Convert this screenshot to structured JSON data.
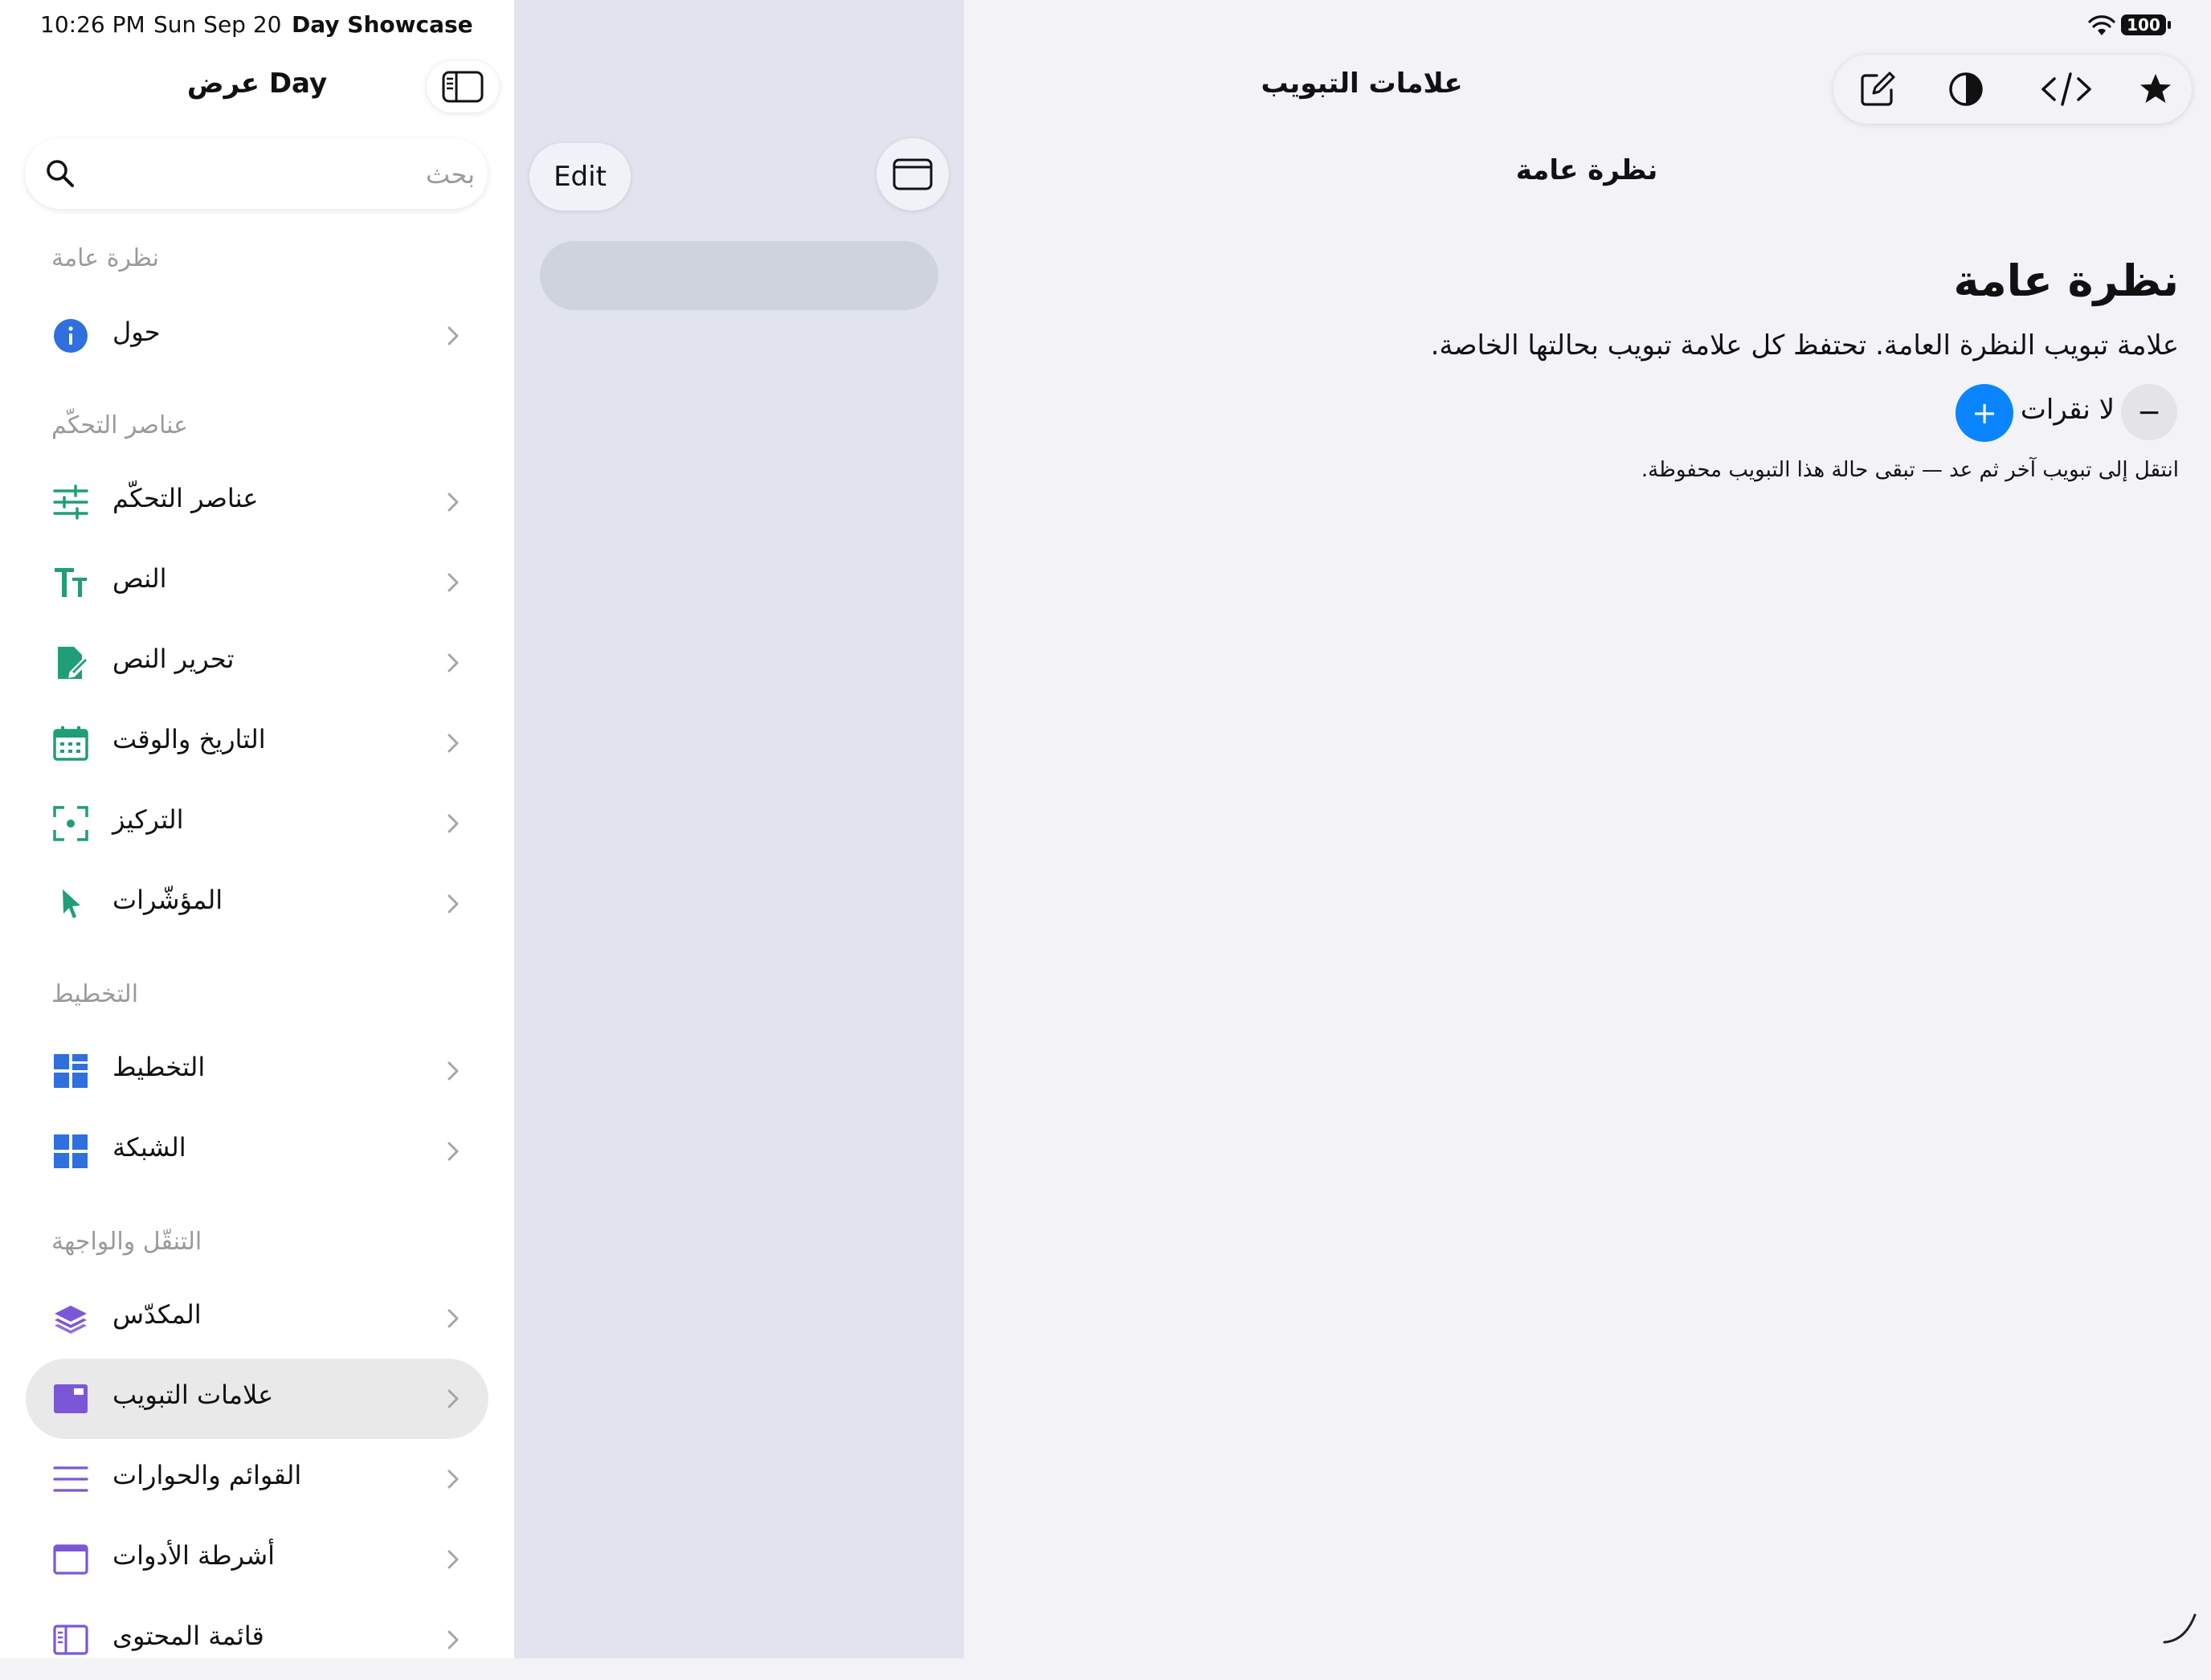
{
  "status_bar": {
    "time": "10:26 PM",
    "date": "Sun Sep 20",
    "app_name": "Day Showcase",
    "battery": "100"
  },
  "sidebar": {
    "title": "عرض Day",
    "search_placeholder": "بحث",
    "sections": [
      {
        "label": "نظرة عامة"
      },
      {
        "label": "عناصر التحكّم"
      },
      {
        "label": "التخطيط"
      },
      {
        "label": "التنقّل والواجهة"
      }
    ],
    "items": [
      {
        "label": "حول",
        "icon": "info-icon",
        "color": "#2f6fde"
      },
      {
        "label": "عناصر التحكّم",
        "icon": "sliders-icon",
        "color": "#1f9e77"
      },
      {
        "label": "النص",
        "icon": "text-size-icon",
        "color": "#1f9e77"
      },
      {
        "label": "تحرير النص",
        "icon": "document-edit-icon",
        "color": "#1f9e77"
      },
      {
        "label": "التاريخ والوقت",
        "icon": "calendar-icon",
        "color": "#1f9e77"
      },
      {
        "label": "التركيز",
        "icon": "focus-icon",
        "color": "#1f9e77"
      },
      {
        "label": "المؤشّرات",
        "icon": "pointer-icon",
        "color": "#1f9e77"
      },
      {
        "label": "التخطيط",
        "icon": "layout-icon",
        "color": "#2f6fde"
      },
      {
        "label": "الشبكة",
        "icon": "grid-icon",
        "color": "#2f6fde"
      },
      {
        "label": "المكدّس",
        "icon": "stack-icon",
        "color": "#7b57d8"
      },
      {
        "label": "علامات التبويب",
        "icon": "tabs-icon",
        "color": "#7b57d8",
        "selected": true
      },
      {
        "label": "القوائم والحوارات",
        "icon": "menu-lines-icon",
        "color": "#7b57d8"
      },
      {
        "label": "أشرطة الأدوات",
        "icon": "toolbar-window-icon",
        "color": "#7b57d8"
      },
      {
        "label": "قائمة المحتوى",
        "icon": "sidebar-list-icon",
        "color": "#7b57d8"
      }
    ]
  },
  "middle": {
    "edit_label": "Edit"
  },
  "detail": {
    "title": "علامات التبويب",
    "nav_title": "نظرة عامة",
    "heading": "نظرة عامة",
    "description": "علامة تبويب النظرة العامة. تحتفظ كل علامة تبويب بحالتها الخاصة.",
    "counter_label": "لا نقرات",
    "decrement_label": "−",
    "increment_label": "+",
    "hint": "انتقل إلى تبويب آخر ثم عد — تبقى حالة هذا التبويب محفوظة.",
    "toolbar_icons": [
      "compose-icon",
      "contrast-icon",
      "code-icon",
      "star-icon"
    ]
  },
  "colors": {
    "accent": "#0a84ff",
    "sidebar_bg": "#ffffff",
    "middle_bg": "#e1e4ee",
    "detail_bg": "#f2f2f7"
  }
}
